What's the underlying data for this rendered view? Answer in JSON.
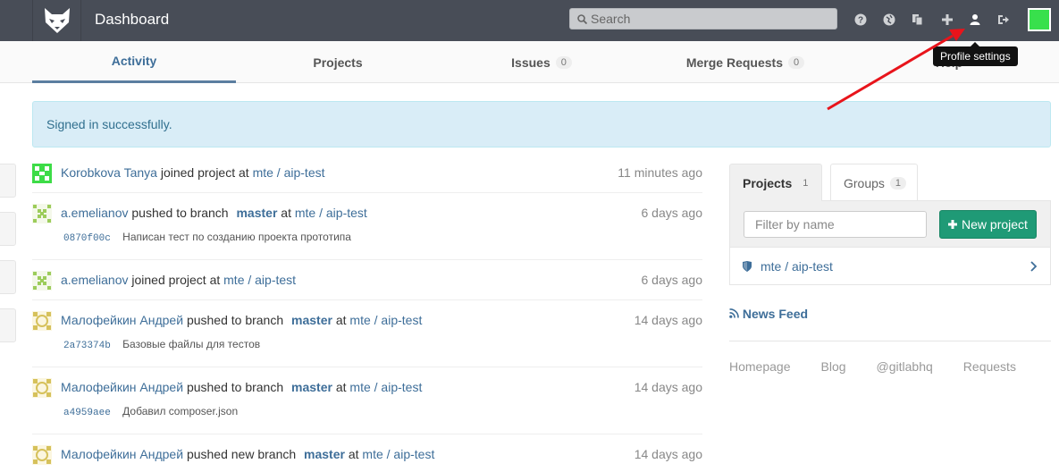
{
  "header": {
    "title": "Dashboard",
    "search_placeholder": "Search",
    "icons": [
      "help-icon",
      "globe-icon",
      "copy-icon",
      "plus-icon",
      "user-icon",
      "sign-out-icon"
    ],
    "tooltip": "Profile settings"
  },
  "nav": {
    "tabs": [
      {
        "label": "Activity",
        "active": true
      },
      {
        "label": "Projects"
      },
      {
        "label": "Issues",
        "count": "0"
      },
      {
        "label": "Merge Requests",
        "count": "0"
      },
      {
        "label": "Help"
      }
    ]
  },
  "flash": "Signed in successfully.",
  "events": [
    {
      "author": "Korobkova Tanya",
      "action": "joined project",
      "at": "at",
      "project": "mte / aip-test",
      "time": "11 minutes ago"
    },
    {
      "author": "a.emelianov",
      "action": "pushed to branch",
      "branch": "master",
      "at": "at",
      "project": "mte / aip-test",
      "time": "6 days ago",
      "sha": "0870f00c",
      "message": "Написан тест по созданию проекта прототипа"
    },
    {
      "author": "a.emelianov",
      "action": "joined project",
      "at": "at",
      "project": "mte / aip-test",
      "time": "6 days ago"
    },
    {
      "author": "Малофейкин Андрей",
      "action": "pushed to branch",
      "branch": "master",
      "at": "at",
      "project": "mte / aip-test",
      "time": "14 days ago",
      "sha": "2a73374b",
      "message": "Базовые файлы для тестов"
    },
    {
      "author": "Малофейкин Андрей",
      "action": "pushed to branch",
      "branch": "master",
      "at": "at",
      "project": "mte / aip-test",
      "time": "14 days ago",
      "sha": "a4959aee",
      "message": "Добавил composer.json"
    },
    {
      "author": "Малофейкин Андрей",
      "action": "pushed new branch",
      "branch": "master",
      "at": "at",
      "project": "mte / aip-test",
      "time": "14 days ago"
    }
  ],
  "right": {
    "tabs": [
      {
        "label": "Projects",
        "count": "1"
      },
      {
        "label": "Groups",
        "count": "1"
      }
    ],
    "filter_placeholder": "Filter by name",
    "new_project": "New project",
    "project": "mte / aip-test",
    "news_feed": "News Feed",
    "footer": [
      "Homepage",
      "Blog",
      "@gitlabhq",
      "Requests"
    ]
  },
  "colors": {
    "header": "#484d57",
    "link": "#3e6e99",
    "success": "#1f9a76",
    "flash_bg": "#d9edf7",
    "annotation_arrow": "#e8141b"
  }
}
